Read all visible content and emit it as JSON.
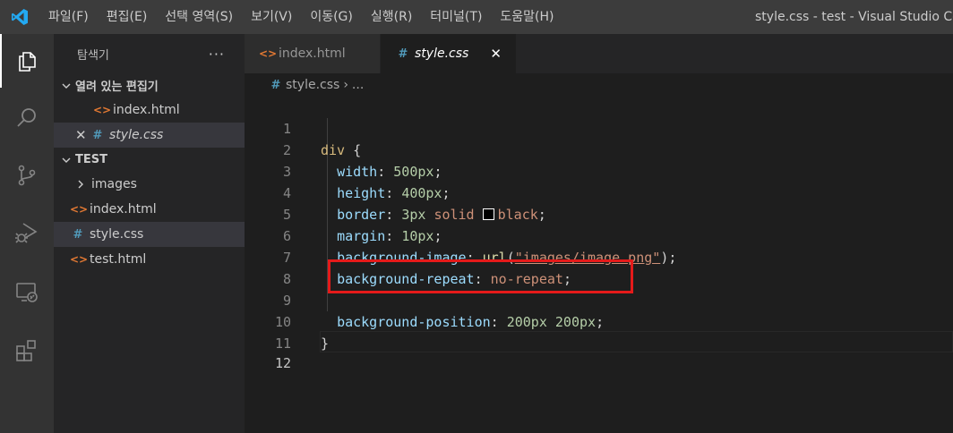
{
  "titlebar": {
    "menu": [
      "파일(F)",
      "편집(E)",
      "선택 영역(S)",
      "보기(V)",
      "이동(G)",
      "실행(R)",
      "터미널(T)",
      "도움말(H)"
    ],
    "window_title": "style.css - test - Visual Studio Code"
  },
  "activity_bar": {
    "items": [
      "explorer-icon",
      "search-icon",
      "source-control-icon",
      "run-debug-icon",
      "remote-explorer-icon",
      "extensions-icon"
    ]
  },
  "sidebar": {
    "title": "탐색기",
    "more": "···",
    "open_editors": {
      "header": "열려 있는 편집기",
      "files": [
        {
          "name": "index.html",
          "type": "html"
        },
        {
          "name": "style.css",
          "type": "css",
          "close": "✕"
        }
      ]
    },
    "workspace": {
      "header": "TEST",
      "items": [
        {
          "name": "images",
          "type": "folder"
        },
        {
          "name": "index.html",
          "type": "html"
        },
        {
          "name": "style.css",
          "type": "css"
        },
        {
          "name": "test.html",
          "type": "html"
        }
      ]
    }
  },
  "tabs": [
    {
      "label": "index.html",
      "icon": "<>"
    },
    {
      "label": "style.css",
      "icon": "#",
      "close": "✕"
    }
  ],
  "breadcrumb": {
    "file": "style.css",
    "separator": "›",
    "rest": "..."
  },
  "editor": {
    "line_numbers": [
      "1",
      "2",
      "3",
      "4",
      "5",
      "6",
      "7",
      "8",
      "9",
      "10",
      "11",
      "12"
    ],
    "code": {
      "l1_sel": "div",
      "l1_brace": " {",
      "l2_prop": "width",
      "l2_val": "500px",
      "l3_prop": "height",
      "l3_val": "400px",
      "l4_prop": "border",
      "l4_num": "3px",
      "l4_style": "solid",
      "l4_color": "black",
      "l5_prop": "margin",
      "l5_val": "10px",
      "l6_prop": "background-image",
      "l6_fn": "url",
      "l6_str": "\"images/image.png\"",
      "l7_prop": "background-repeat",
      "l7_val": "no-repeat",
      "l9_prop": "background-position",
      "l9_val": "200px 200px",
      "l10_brace": "}"
    }
  },
  "colors": {
    "highlight_box": "#e51a1a",
    "accent": "#007acc"
  }
}
